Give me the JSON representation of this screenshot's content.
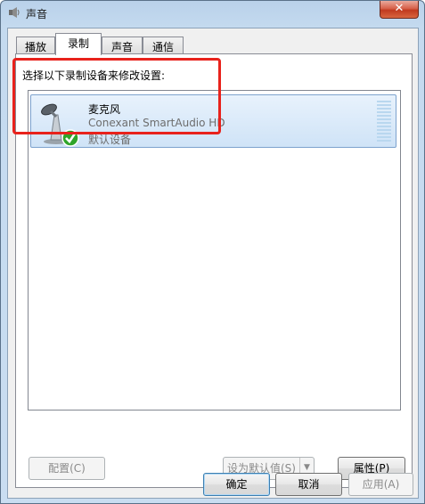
{
  "window": {
    "title": "声音",
    "close_symbol": "✕"
  },
  "tabs": [
    {
      "label": "播放"
    },
    {
      "label": "录制"
    },
    {
      "label": "声音"
    },
    {
      "label": "通信"
    }
  ],
  "active_tab": "录制",
  "panel": {
    "instruction": "选择以下录制设备来修改设置:"
  },
  "devices": [
    {
      "name": "麦克风",
      "model": "Conexant SmartAudio HD",
      "status": "默认设备",
      "icon": "microphone-icon",
      "badge": "default-check-icon",
      "selected": true
    }
  ],
  "buttons": {
    "configure": "配置(C)",
    "set_default": "设为默认值(S)",
    "properties": "属性(P)",
    "ok": "确定",
    "cancel": "取消",
    "apply": "应用(A)"
  },
  "colors": {
    "highlight": "#e8221c",
    "selection": "#cfe3f7",
    "check": "#2fa52a"
  }
}
